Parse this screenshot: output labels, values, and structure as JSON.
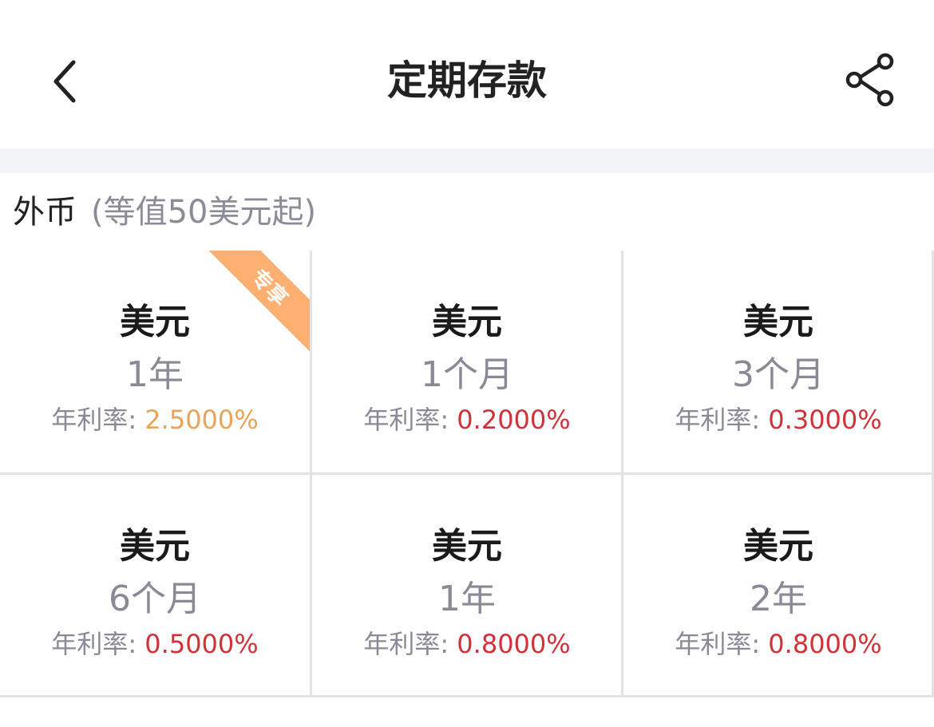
{
  "header": {
    "title": "定期存款",
    "back_icon": "chevron-left-icon",
    "share_icon": "share-icon"
  },
  "section": {
    "title": "外币",
    "subtitle": "(等值50美元起)"
  },
  "rate_label": "年利率:",
  "products": [
    {
      "currency": "美元",
      "term": "1年",
      "rate": "2.5000%",
      "badge": "专享",
      "rate_color": "#e9a35a"
    },
    {
      "currency": "美元",
      "term": "1个月",
      "rate": "0.2000%",
      "rate_color": "#d0323a"
    },
    {
      "currency": "美元",
      "term": "3个月",
      "rate": "0.3000%",
      "rate_color": "#d0323a"
    },
    {
      "currency": "美元",
      "term": "6个月",
      "rate": "0.5000%",
      "rate_color": "#d0323a"
    },
    {
      "currency": "美元",
      "term": "1年",
      "rate": "0.8000%",
      "rate_color": "#d0323a"
    },
    {
      "currency": "美元",
      "term": "2年",
      "rate": "0.8000%",
      "rate_color": "#d0323a"
    }
  ],
  "colors": {
    "accent_red": "#d0323a",
    "accent_gold": "#e9a35a",
    "badge_bg": "#fdb072",
    "band_bg": "#f3f4f8"
  }
}
